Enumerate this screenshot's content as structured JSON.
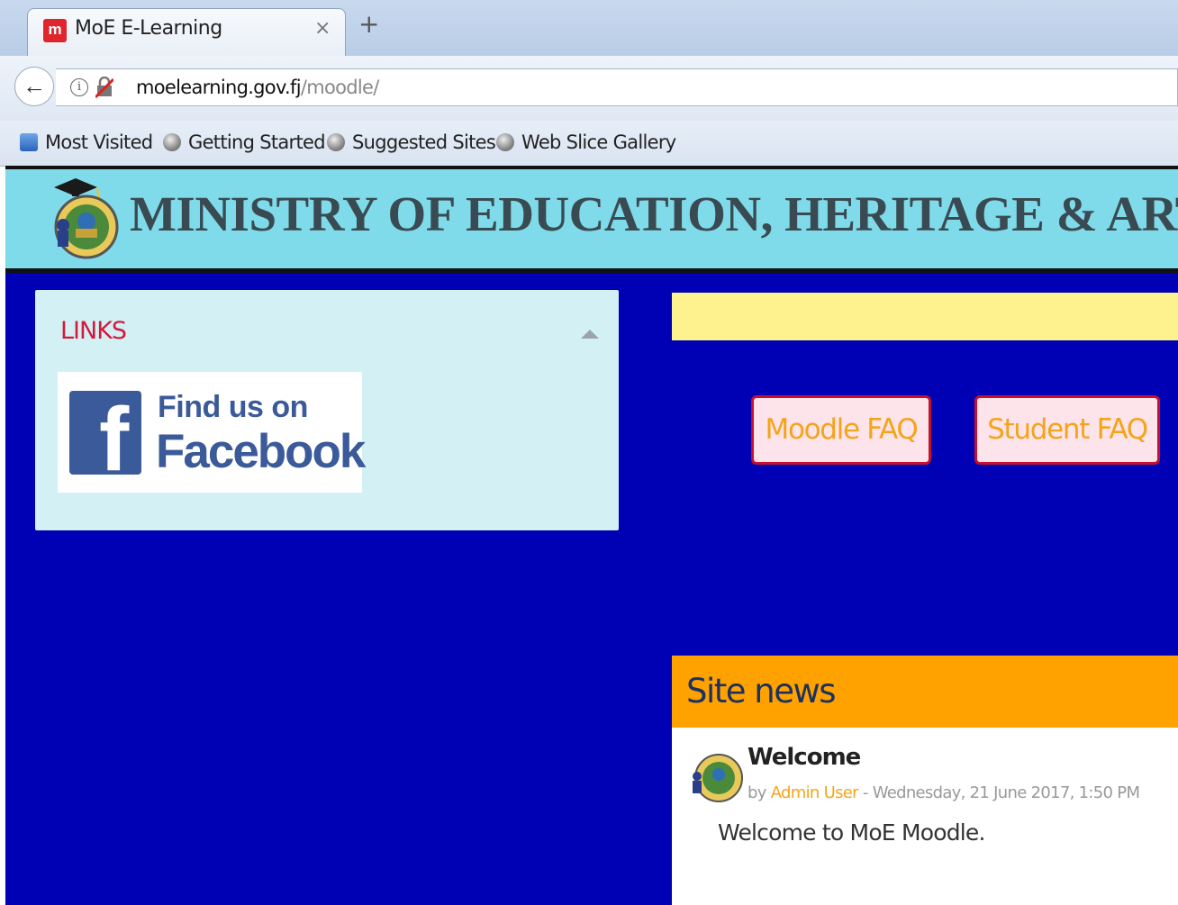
{
  "browser": {
    "tab": {
      "title": "MoE E-Learning",
      "favicon_letter": "m",
      "close_glyph": "×"
    },
    "new_tab_glyph": "+",
    "address": {
      "domain": "moelearning.gov.fj",
      "path": "/moodle/"
    },
    "bookmarks": [
      {
        "label": "Most Visited",
        "icon": "bookmark-star-icon"
      },
      {
        "label": "Getting Started",
        "icon": "globe-icon"
      },
      {
        "label": "Suggested Sites",
        "icon": "globe-icon"
      },
      {
        "label": "Web Slice Gallery",
        "icon": "globe-icon"
      }
    ]
  },
  "site": {
    "title": "MINISTRY OF EDUCATION, HERITAGE & ARTS",
    "colors": {
      "header": "#7fdbe9",
      "background": "#0000b4",
      "accent_red": "#d41a3c",
      "accent_orange": "#ffa200"
    }
  },
  "links_block": {
    "title": "LINKS",
    "facebook_badge": {
      "line1": "Find us on",
      "line2": "Facebook",
      "logo_letter": "f"
    }
  },
  "faq_buttons": [
    {
      "label": "Moodle FAQ"
    },
    {
      "label": "Student FAQ"
    }
  ],
  "site_news": {
    "title": "Site news",
    "post": {
      "title": "Welcome",
      "by": "by",
      "author": "Admin User",
      "date": "- Wednesday, 21 June 2017, 1:50 PM",
      "content": "Welcome to MoE Moodle."
    }
  }
}
